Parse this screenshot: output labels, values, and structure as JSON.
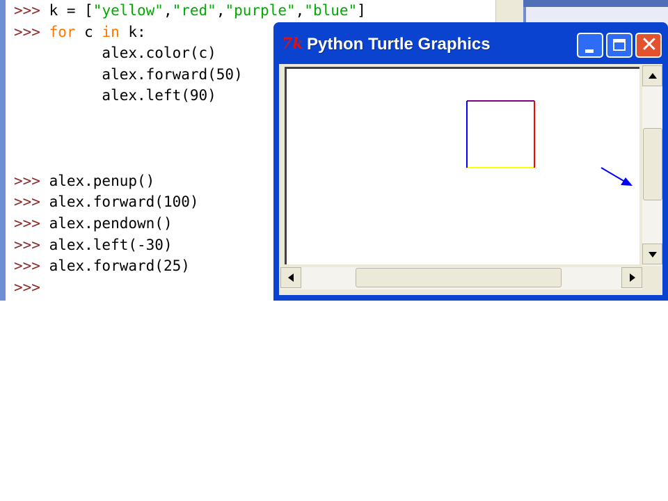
{
  "shell": {
    "lines": [
      [
        {
          "t": ">>> ",
          "c": "prompt"
        },
        {
          "t": "k = [",
          "c": ""
        },
        {
          "t": "\"yellow\"",
          "c": "str"
        },
        {
          "t": ",",
          "c": ""
        },
        {
          "t": "\"red\"",
          "c": "str"
        },
        {
          "t": ",",
          "c": ""
        },
        {
          "t": "\"purple\"",
          "c": "str"
        },
        {
          "t": ",",
          "c": ""
        },
        {
          "t": "\"blue\"",
          "c": "str"
        },
        {
          "t": "]",
          "c": ""
        }
      ],
      [
        {
          "t": ">>> ",
          "c": "prompt"
        },
        {
          "t": "for",
          "c": "kw"
        },
        {
          "t": " c ",
          "c": ""
        },
        {
          "t": "in",
          "c": "kw"
        },
        {
          "t": " k:",
          "c": ""
        }
      ],
      [
        {
          "t": "          alex.color(c)",
          "c": ""
        }
      ],
      [
        {
          "t": "          alex.forward(50)",
          "c": ""
        }
      ],
      [
        {
          "t": "          alex.left(90)",
          "c": ""
        }
      ],
      [],
      [],
      [],
      [
        {
          "t": ">>> ",
          "c": "prompt"
        },
        {
          "t": "alex.penup()",
          "c": ""
        }
      ],
      [
        {
          "t": ">>> ",
          "c": "prompt"
        },
        {
          "t": "alex.forward(100)",
          "c": ""
        }
      ],
      [
        {
          "t": ">>> ",
          "c": "prompt"
        },
        {
          "t": "alex.pendown()",
          "c": ""
        }
      ],
      [
        {
          "t": ">>> ",
          "c": "prompt"
        },
        {
          "t": "alex.left(-30)",
          "c": ""
        }
      ],
      [
        {
          "t": ">>> ",
          "c": "prompt"
        },
        {
          "t": "alex.forward(25)",
          "c": ""
        }
      ],
      [
        {
          "t": ">>> ",
          "c": "prompt"
        }
      ]
    ]
  },
  "turtle_window": {
    "title": "Python Turtle Graphics",
    "icon_text": "7k",
    "close_glyph": "✕",
    "drawing": {
      "square_edge_colors": [
        "yellow",
        "red",
        "purple",
        "blue"
      ],
      "turtle_color": "#0000ff",
      "turtle_heading_deg": -30
    }
  },
  "colors": {
    "titlebar": "#0a43d0",
    "prompt": "#8b2c2c",
    "keyword": "#ff7700",
    "string": "#00aa00"
  }
}
